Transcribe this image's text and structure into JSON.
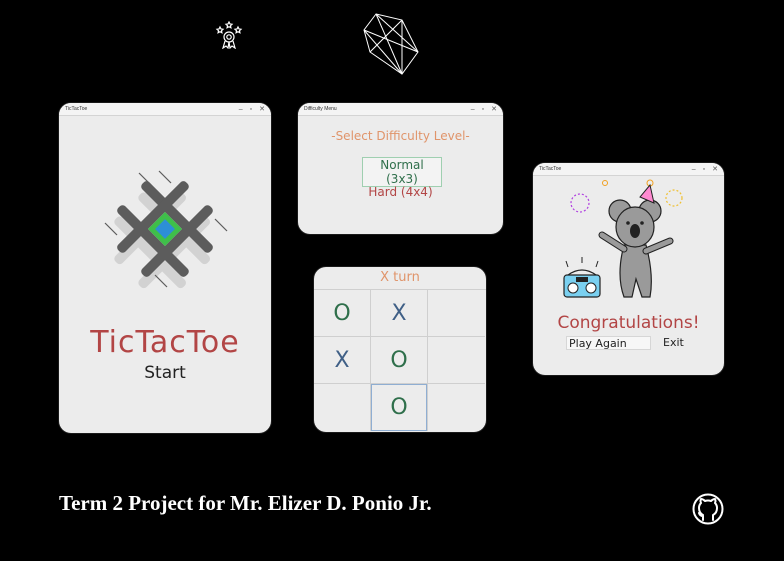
{
  "start_window": {
    "title": "TicTacToe",
    "app_name": "TicTacToe",
    "start_label": "Start"
  },
  "difficulty_window": {
    "title": "Difficulty Menu",
    "heading": "-Select Difficulty Level-",
    "normal_label": "Normal (3x3)",
    "hard_label": "Hard (4x4)"
  },
  "board_window": {
    "turn_text": "X turn",
    "cells": [
      "O",
      "X",
      "",
      "X",
      "O",
      "",
      "",
      "O",
      ""
    ]
  },
  "congrats_window": {
    "title": "TicTacToe",
    "message": "Congratulations!",
    "play_again_label": "Play Again",
    "exit_label": "Exit"
  },
  "footer": {
    "text": "Term 2 Project for Mr. Elizer D. Ponio Jr."
  },
  "icons": [
    "award-icon",
    "polygon-logo-icon",
    "github-icon"
  ],
  "colors": {
    "title_red": "#b24545",
    "accent_orange": "#e0946a",
    "o_green": "#2f6f4b",
    "x_blue": "#3f5f86"
  }
}
